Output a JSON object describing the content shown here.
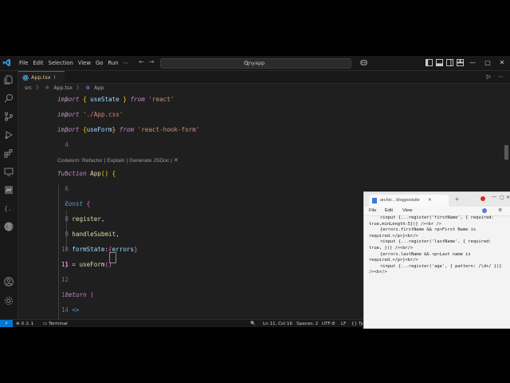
{
  "app": {
    "menu": [
      "File",
      "Edit",
      "Selection",
      "View",
      "Go",
      "Run",
      "⋯"
    ],
    "command_center": "myapp",
    "accent_color": "#0078d4"
  },
  "tab": {
    "name": "App.tsx",
    "dirty_marker": "!"
  },
  "breadcrumb": [
    "src",
    "〉",
    "App.tsx",
    "〉",
    "App"
  ],
  "codelens": "Codeium: Refactor | Explain | Generate JSDoc | ✕",
  "code_lines": [
    {
      "n": "1",
      "html": "<span class=\"kw\">import</span> <span class=\"brk2\">{</span> <span class=\"id\">useState</span> <span class=\"brk2\">}</span> <span class=\"kw\">from</span> <span class=\"str\">'react'</span>"
    },
    {
      "n": "2",
      "html": "<span class=\"kw\">import</span> <span class=\"str\">'./App.css'</span>"
    },
    {
      "n": "3",
      "html": "<span class=\"kw\">import</span> <span class=\"brk2\">{</span><span class=\"id\">useForm</span><span class=\"brk2\">}</span> <span class=\"kw\">from</span> <span class=\"str\">'react-hook-form'</span>"
    },
    {
      "n": "4",
      "html": ""
    },
    {
      "n": "5",
      "html": "<span class=\"kw\">function</span> <span class=\"fn\">App</span><span class=\"brk2\">()</span> <span class=\"brk2\">{</span>"
    },
    {
      "n": "6",
      "html": ""
    },
    {
      "n": "7",
      "html": "  <span class=\"kwb\">const</span> <span class=\"brk\">{</span>"
    },
    {
      "n": "8",
      "html": "    <span class=\"fn\">register</span>,"
    },
    {
      "n": "9",
      "html": "    <span class=\"fn\">handleSubmit</span>,"
    },
    {
      "n": "10",
      "html": "    <span class=\"id\">formState</span>:<span class=\"brk\">{</span><span class=\"id\">errors</span><span class=\"brk\">}</span>"
    },
    {
      "n": "11",
      "html": "  <span class=\"brk\">}</span> = <span class=\"fn\">useForm</span><span class=\"brk\">()</span>"
    },
    {
      "n": "12",
      "html": ""
    },
    {
      "n": "13",
      "html": "  <span class=\"kw\">return</span> <span class=\"brk\">(</span>"
    },
    {
      "n": "14",
      "html": "    <span class=\"kwb\">&lt;&gt;</span>"
    }
  ],
  "status": {
    "problems": "⊗ 0 ⚠ 1",
    "terminal": "Terminal",
    "cursor": "Ln 11, Col 16",
    "spaces": "Spaces: 2",
    "encoding": "UTF-8",
    "eol": "LF",
    "lang": "{} Ty"
  },
  "browser": {
    "tab_title": "archiv... blogpostsite",
    "tab_close": "✕",
    "plus": "+",
    "controls": [
      "—",
      "▢",
      "✕"
    ],
    "menu": [
      "File",
      "Edit",
      "View"
    ],
    "source_lines": [
      "<input {...register('firstName', { required:",
      "true,minLength:5})} /><br />",
      "{errors.firstName && <p>First Name is",
      "required.</p>}<br/>",
      "<input {...register('lastName', { required:",
      "true, })} /><br/>",
      "{errors.lastName && <p>Last name is",
      "required.</p>}<br/>",
      "<input {...register('age', { pattern: /\\d+/ })}",
      "/><br/>"
    ]
  }
}
